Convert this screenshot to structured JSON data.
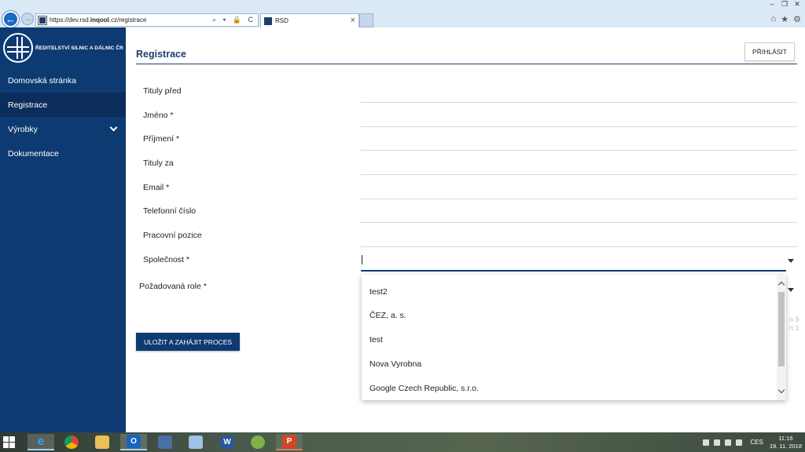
{
  "browser": {
    "url_prefix": "https://dev.rsd.",
    "url_host": "inqool",
    "url_suffix": ".cz/registrace",
    "tab_title": "RSD",
    "tab_close": "×",
    "back_icon": "←",
    "forward_icon": "→",
    "address_icons": "⌕ ▾ 🔒 C",
    "window_controls": [
      "–",
      "❐",
      "✕"
    ],
    "tools": [
      "⌂",
      "★",
      "⚙"
    ]
  },
  "sidebar": {
    "logo_text": "ŘEDITELSTVÍ SILNIC A DÁLNIC ČR",
    "items": [
      {
        "label": "Domovská stránka"
      },
      {
        "label": "Registrace"
      },
      {
        "label": "Výrobky"
      },
      {
        "label": "Dokumentace"
      }
    ]
  },
  "header": {
    "title": "Registrace",
    "login_label": "PŘIHLÁSIT"
  },
  "form": {
    "fields": [
      {
        "label": "Tituly před",
        "value": ""
      },
      {
        "label": "Jméno *",
        "value": ""
      },
      {
        "label": "Příjmení *",
        "value": ""
      },
      {
        "label": "Tituly za",
        "value": ""
      },
      {
        "label": "Email *",
        "value": ""
      },
      {
        "label": "Telefonní číslo",
        "value": ""
      },
      {
        "label": "Pracovní pozice",
        "value": ""
      },
      {
        "label": "Společnost *",
        "value": ""
      },
      {
        "label": "Požadovaná role *",
        "value": ""
      }
    ],
    "submit_label": "ULOŽIT A ZAHÁJIT PROCES"
  },
  "company_dropdown": {
    "options": [
      "test2",
      "ČEZ, a. s.",
      "test",
      "Nova Vyrobna",
      "Google Czech Republic, s.r.o."
    ]
  },
  "hidden_hint": [
    "n 9",
    "n 1"
  ],
  "taskbar": {
    "apps": [
      {
        "label": "e"
      },
      {
        "label": ""
      },
      {
        "label": ""
      },
      {
        "label": "O"
      },
      {
        "label": ""
      },
      {
        "label": ""
      },
      {
        "label": "W"
      },
      {
        "label": ""
      },
      {
        "label": "P"
      }
    ],
    "language": "CES",
    "time": "11:16",
    "date": "19. 11. 2018"
  },
  "colors": {
    "brand_blue": "#0e3a72",
    "chrome_blue": "#dbe8f5"
  }
}
